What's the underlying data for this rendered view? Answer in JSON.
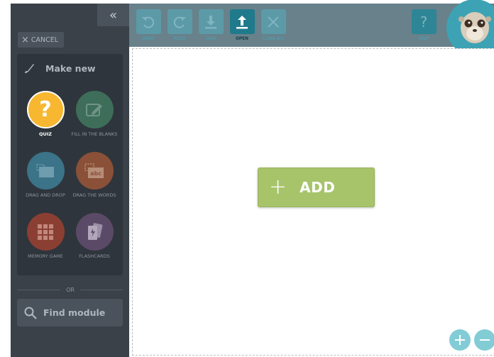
{
  "sidebar": {
    "collapse_icon": "«",
    "cancel_label": "CANCEL",
    "make_new_title": "Make new",
    "tiles": [
      {
        "label": "QUIZ",
        "color": "#f7b731",
        "icon": "question-icon"
      },
      {
        "label": "FILL IN THE BLANKS",
        "color": "#3e6e5a",
        "icon": "pencil-icon"
      },
      {
        "label": "DRAG AND DROP",
        "color": "#3b7388",
        "icon": "drag-icon"
      },
      {
        "label": "DRAG THE WORDS",
        "color": "#8a5138",
        "icon": "abc-icon"
      },
      {
        "label": "MEMORY GAME",
        "color": "#8b3f33",
        "icon": "grid-icon"
      },
      {
        "label": "FLASHCARDS",
        "color": "#5a4a67",
        "icon": "cards-icon"
      }
    ],
    "or_text": "OR",
    "find_label": "Find module"
  },
  "toolbar": {
    "buttons": [
      {
        "label": "UNDO",
        "icon": "undo-icon"
      },
      {
        "label": "REDO",
        "icon": "redo-icon"
      },
      {
        "label": "SAVE",
        "icon": "save-icon"
      },
      {
        "label": "OPEN",
        "icon": "open-icon"
      },
      {
        "label": "CLEAR ALL",
        "icon": "close-icon"
      }
    ],
    "help_label": "HELP"
  },
  "canvas": {
    "add_label": "ADD"
  }
}
